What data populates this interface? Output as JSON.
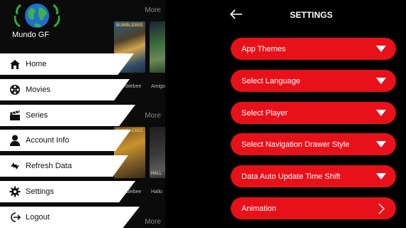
{
  "colors": {
    "accent_red": "#e8111a",
    "drawer_item_bg": "#ffffff",
    "background": "#000000"
  },
  "drawer": {
    "app_name": "Mundo GF",
    "items": [
      {
        "label": "Home",
        "icon": "home-icon"
      },
      {
        "label": "Movies",
        "icon": "film-reel-icon"
      },
      {
        "label": "Series",
        "icon": "clapperboard-icon"
      },
      {
        "label": "Account Info",
        "icon": "user-icon"
      },
      {
        "label": "Refresh Data",
        "icon": "refresh-arrows-icon"
      },
      {
        "label": "Settings",
        "icon": "gear-icon"
      },
      {
        "label": "Logout",
        "icon": "logout-icon"
      }
    ]
  },
  "content": {
    "more_label": "More",
    "row1": [
      {
        "poster_title": "BUMBLEBEE",
        "caption": "Bumblebee"
      },
      {
        "poster_title": "",
        "caption": "Amigo"
      }
    ],
    "row2": [
      {
        "poster_title": "BUMBLEBEE",
        "caption": "Bumblebee"
      },
      {
        "poster_title": "HALL",
        "caption": "Hallo"
      }
    ]
  },
  "settings": {
    "title": "SETTINGS",
    "rows": [
      {
        "label": "App Themes",
        "icon": "triangle-down-icon"
      },
      {
        "label": "Select Language",
        "icon": "triangle-down-icon"
      },
      {
        "label": "Select Player",
        "icon": "triangle-down-icon"
      },
      {
        "label": "Select Navigation Drawer Style",
        "icon": "triangle-down-icon"
      },
      {
        "label": "Data Auto Update Time Shift",
        "icon": "triangle-down-icon"
      },
      {
        "label": "Animation",
        "icon": "chevron-right-icon"
      }
    ]
  }
}
